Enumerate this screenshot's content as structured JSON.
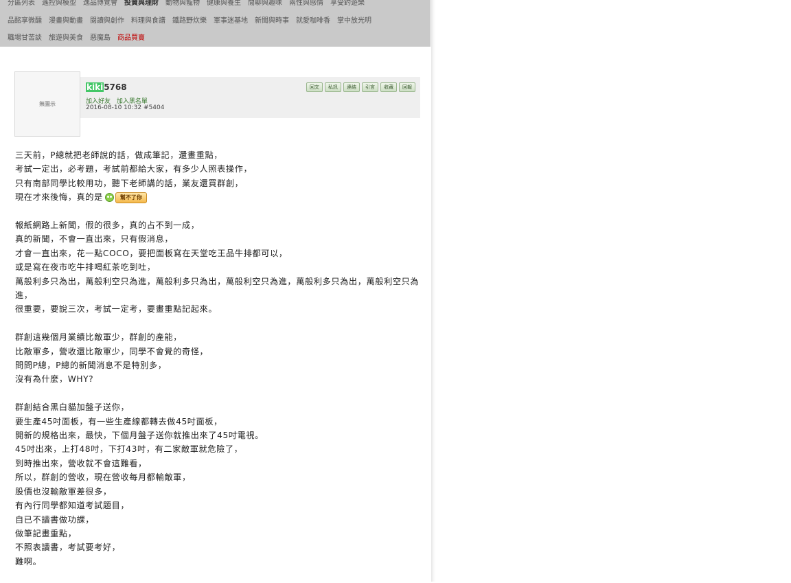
{
  "categories": {
    "row1": [
      "分區列表",
      "遙控與模型",
      "逸品博覽會",
      "投資與理財",
      "動物與寵物",
      "健康與養生",
      "閒聊與趣味",
      "兩性與感情",
      "享受釣遊樂"
    ],
    "row1_bold_index": 3,
    "row2": [
      "品酩享微醺",
      "漫畫與動畫",
      "閱讀與創作",
      "料理與食譜",
      "鐵路野炊樂",
      "軍事迷基地",
      "新聞與時事",
      "就愛咖啡香",
      "掌中放光明"
    ],
    "row3": [
      "職場甘苦談",
      "旅遊與美食",
      "惡魔島",
      "商品買賣"
    ],
    "row3_red_index": 3
  },
  "user": {
    "avatar_text": "無圖示",
    "name_highlight": "kiki",
    "name_rest": "5768",
    "add_friend": "加入好友",
    "add_blacklist": "加入黑名單",
    "timestamp": "2016-08-10 10:32",
    "post_number": "#5404",
    "highlight_color": "#44c767"
  },
  "actions": [
    "回文",
    "私訊",
    "連結",
    "引言",
    "收藏",
    "回報"
  ],
  "post": {
    "paragraphs": [
      [
        "三天前，P總就把老師說的話，做成筆記，還畫重點，",
        "考試一定出，必考題，考試前都給大家，有多少人照表操作，",
        "只有南部同學比較用功，聽下老師講的話，業友還買群創，",
        "現在才來後悔，真的是"
      ],
      [
        "報紙網路上新聞，假的很多，真的占不到一成，",
        "真的新聞，不會一直出來，只有假消息，",
        "才會一直出來，花一點COCO，要把面板寫在天堂吃王品牛排都可以，",
        "或是寫在夜市吃牛排喝紅茶吃到吐，",
        "萬般利多只為出，萬般利空只為進，萬般利多只為出，萬般利空只為進，萬般利多只為出，萬般利空只為進，",
        "很重要，要說三次，考試一定考，要畫重點記起來。"
      ],
      [
        "群創這幾個月業績比敵軍少，群創的產能，",
        "比敵軍多，營收還比敵軍少，同學不會覺的奇怪，",
        "問問P總，P總的新聞消息不是特別多，",
        "沒有為什麼，WHY?"
      ],
      [
        "群創結合黑白貓加盤子送你，",
        "要生產45吋面板，有一些生產線都轉去做45吋面板，",
        "開新的規格出來，最快，下個月盤子送你就推出來了45吋電視。",
        "45吋出來，上打48吋，下打43吋，有二家敵軍就危險了，",
        "到時推出來，營收就不會這難看，",
        "所以，群創的營收，現在營收每月都輸敵軍，",
        "股價也沒輸敵軍差很多，",
        "有內行同學都知道考試題目，",
        "自已不讀書做功課，",
        "做筆記畫重點，",
        "不照表讀書，考試要考好，",
        "難啊。"
      ]
    ],
    "emoticon_label": "幫不了你"
  }
}
